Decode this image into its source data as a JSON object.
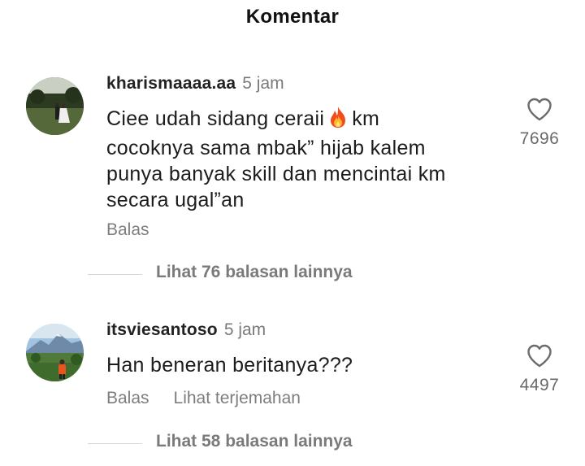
{
  "header": {
    "title": "Komentar"
  },
  "comments": [
    {
      "username": "kharismaaaa.aa",
      "time": "5 jam",
      "text_before_emoji": "Ciee udah sidang ceraii",
      "text_after_emoji": "km",
      "text_lines": [
        "cocoknya sama mbak” hijab kalem",
        "punya banyak skill dan mencintai km",
        "secara ugal”an"
      ],
      "emoji": "fire-emoji",
      "reply_label": "Balas",
      "like_count": "7696",
      "more_replies": "Lihat 76 balasan lainnya"
    },
    {
      "username": "itsviesantoso",
      "time": "5 jam",
      "text": "Han beneran beritanya???",
      "reply_label": "Balas",
      "translate_label": "Lihat terjemahan",
      "like_count": "4497",
      "more_replies": "Lihat 58 balasan lainnya"
    }
  ],
  "icons": {
    "like": "heart-outline-icon"
  }
}
